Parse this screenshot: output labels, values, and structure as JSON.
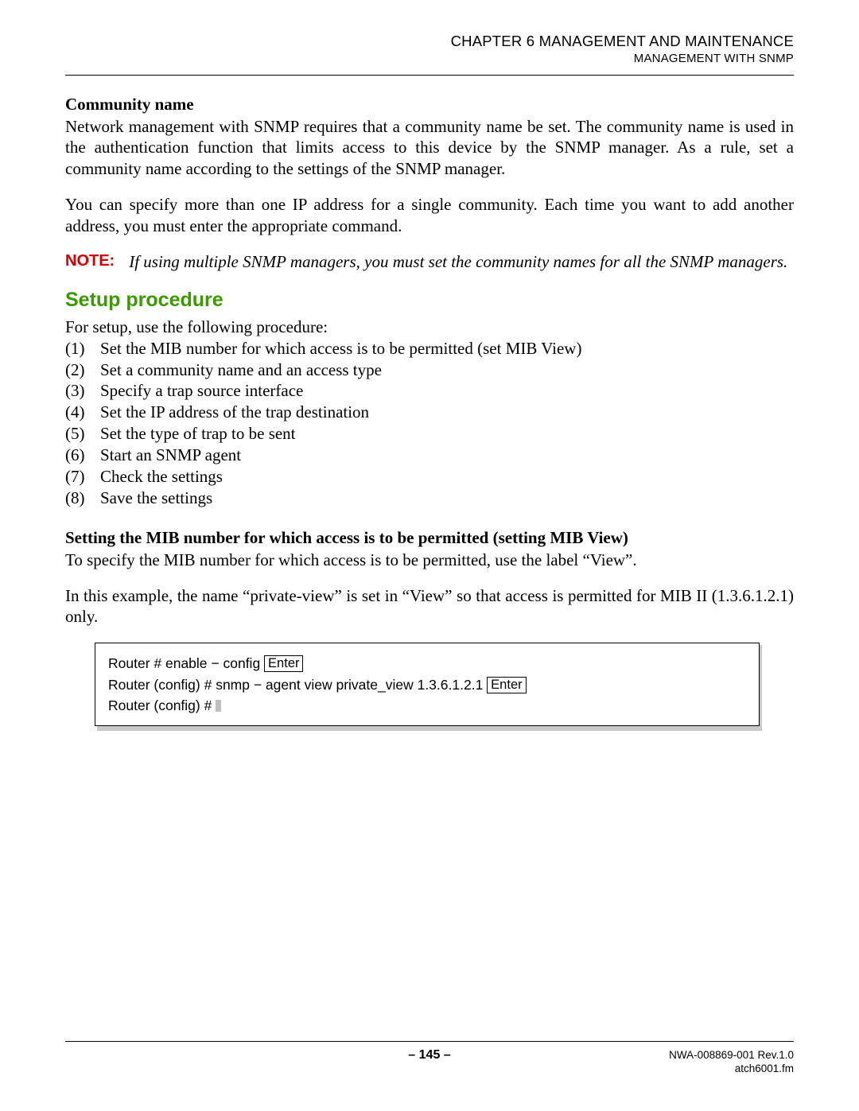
{
  "header": {
    "chapter": "CHAPTER 6  MANAGEMENT AND MAINTENANCE",
    "subtitle": "MANAGEMENT WITH SNMP"
  },
  "community": {
    "heading": "Community name",
    "p1": "Network management with SNMP requires that a community name be set. The community name is used in the authentication function that limits access to this device by the SNMP manager. As a rule, set a community name according to the settings of the SNMP manager.",
    "p2": "You can specify more than one IP address for a single community. Each time you want to add another address, you must enter the appropriate command."
  },
  "note": {
    "label": "NOTE:",
    "text": "If using multiple SNMP managers, you must set the community names for all the SNMP managers."
  },
  "setup": {
    "heading": "Setup procedure",
    "intro": "For setup, use the following procedure:",
    "steps": [
      "Set the MIB number for which access is to be permitted (set MIB View)",
      "Set a community name and an access type",
      "Specify a trap source interface",
      "Set the IP address of the trap destination",
      "Set the type of trap to be sent",
      "Start an SNMP agent",
      "Check the settings",
      "Save the settings"
    ]
  },
  "mib": {
    "heading": "Setting the MIB number for which access is to be permitted (setting MIB View)",
    "p1": "To specify the MIB number for which access is to be permitted, use the label “View”.",
    "p2": "In this example, the name “private-view” is set in “View” so that access is permitted for MIB II (1.3.6.1.2.1) only."
  },
  "code": {
    "line1_pre": "Router # enable − config ",
    "enter": "Enter",
    "line2_pre": "Router (config) # snmp − agent view private_view 1.3.6.1.2.1 ",
    "line3": "Router (config) # "
  },
  "footer": {
    "page": "– 145 –",
    "doc": "NWA-008869-001 Rev.1.0",
    "file": "atch6001.fm"
  }
}
